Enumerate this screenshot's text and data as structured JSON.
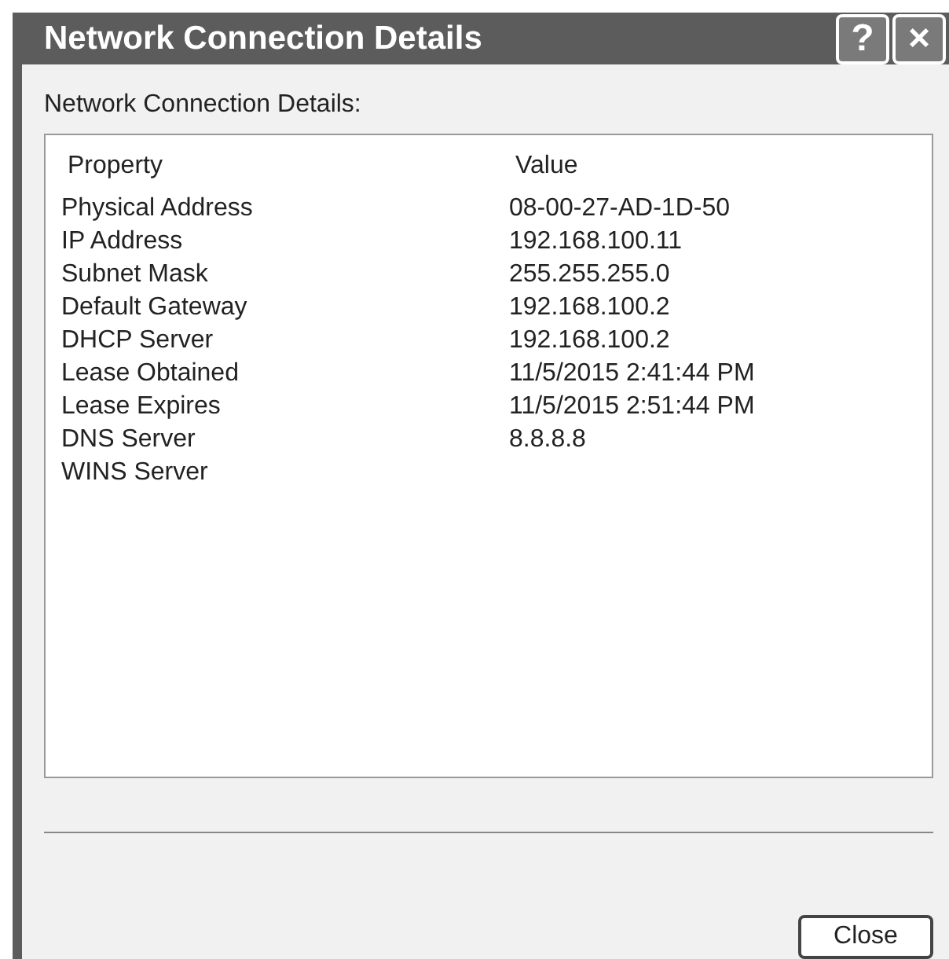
{
  "window": {
    "title": "Network Connection Details",
    "title_buttons": [
      "?",
      "×"
    ]
  },
  "label": "Network Connection Details:",
  "table": {
    "columns": [
      "Property",
      "Value"
    ],
    "rows": [
      [
        "Physical Address",
        "08-00-27-AD-1D-50"
      ],
      [
        "IP Address",
        "192.168.100.11"
      ],
      [
        "Subnet Mask",
        "255.255.255.0"
      ],
      [
        "Default Gateway",
        "192.168.100.2"
      ],
      [
        "DHCP Server",
        "192.168.100.2"
      ],
      [
        "Lease Obtained",
        "11/5/2015 2:41:44 PM"
      ],
      [
        "Lease Expires",
        "11/5/2015 2:51:44 PM"
      ],
      [
        "DNS Server",
        "8.8.8.8"
      ],
      [
        "WINS Server",
        ""
      ]
    ]
  },
  "buttons": [
    "Close"
  ]
}
